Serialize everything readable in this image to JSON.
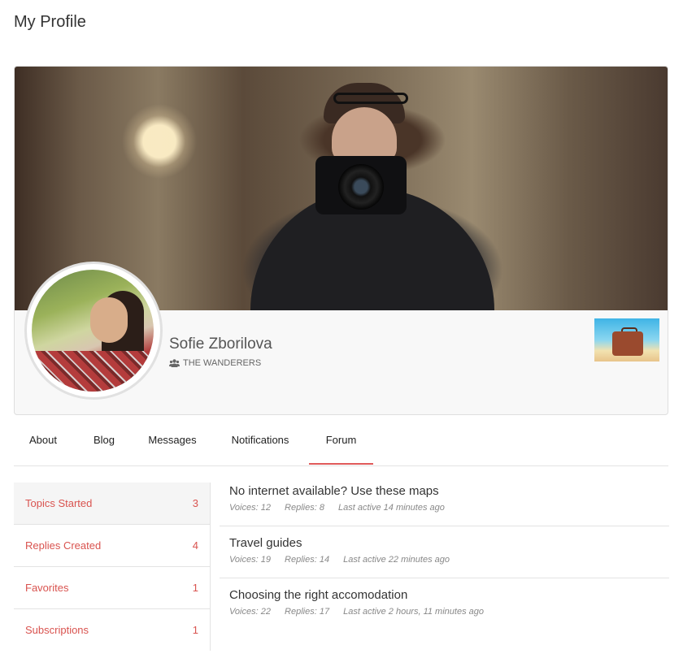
{
  "page": {
    "title": "My Profile"
  },
  "profile": {
    "name": "Sofie Zborilova",
    "group": "THE WANDERERS"
  },
  "tabs": [
    {
      "label": "About"
    },
    {
      "label": "Blog"
    },
    {
      "label": "Messages"
    },
    {
      "label": "Notifications"
    },
    {
      "label": "Forum",
      "active": true
    }
  ],
  "sidebar": {
    "items": [
      {
        "label": "Topics Started",
        "count": "3"
      },
      {
        "label": "Replies Created",
        "count": "4"
      },
      {
        "label": "Favorites",
        "count": "1"
      },
      {
        "label": "Subscriptions",
        "count": "1"
      }
    ]
  },
  "topics": [
    {
      "title": "No internet available? Use these maps",
      "voices": "Voices: 12",
      "replies": "Replies: 8",
      "last_active": "Last active 14 minutes ago"
    },
    {
      "title": "Travel guides",
      "voices": "Voices: 19",
      "replies": "Replies: 14",
      "last_active": "Last active 22 minutes ago"
    },
    {
      "title": "Choosing the right accomodation",
      "voices": "Voices: 22",
      "replies": "Replies: 17",
      "last_active": "Last active 2 hours, 11 minutes ago"
    }
  ],
  "colors": {
    "accent": "#d9534f",
    "tab_underline": "#e05a5a"
  },
  "icons": {
    "group": "group-icon"
  }
}
